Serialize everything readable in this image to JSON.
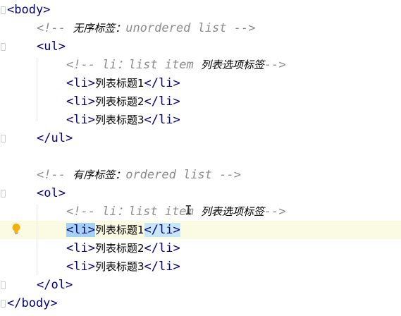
{
  "lines": [
    {
      "indent": 0,
      "tokens": [
        {
          "t": "tag",
          "v": "<body>"
        }
      ]
    },
    {
      "indent": 1,
      "tokens": [
        {
          "t": "comment",
          "v": "<!-- "
        },
        {
          "t": "comment-cn",
          "v": "无序标签："
        },
        {
          "t": "comment",
          "v": "unordered list -->"
        }
      ]
    },
    {
      "indent": 1,
      "tokens": [
        {
          "t": "tag",
          "v": "<ul>"
        }
      ]
    },
    {
      "indent": 2,
      "tokens": [
        {
          "t": "comment",
          "v": "<!-- li："
        },
        {
          "t": "comment",
          "v": "list item "
        },
        {
          "t": "comment-cn",
          "v": "列表选项标签"
        },
        {
          "t": "comment",
          "v": "-->"
        }
      ]
    },
    {
      "indent": 2,
      "tokens": [
        {
          "t": "tag",
          "v": "<li>"
        },
        {
          "t": "text",
          "v": "列表标题1"
        },
        {
          "t": "tag",
          "v": "</li>"
        }
      ]
    },
    {
      "indent": 2,
      "tokens": [
        {
          "t": "tag",
          "v": "<li>"
        },
        {
          "t": "text",
          "v": "列表标题2"
        },
        {
          "t": "tag",
          "v": "</li>"
        }
      ]
    },
    {
      "indent": 2,
      "tokens": [
        {
          "t": "tag",
          "v": "<li>"
        },
        {
          "t": "text",
          "v": "列表标题3"
        },
        {
          "t": "tag",
          "v": "</li>"
        }
      ]
    },
    {
      "indent": 1,
      "tokens": [
        {
          "t": "tag",
          "v": "</ul>"
        }
      ]
    },
    {
      "indent": 0,
      "tokens": []
    },
    {
      "indent": 1,
      "tokens": [
        {
          "t": "comment",
          "v": "<!-- "
        },
        {
          "t": "comment-cn",
          "v": "有序标签："
        },
        {
          "t": "comment",
          "v": "ordered list -->"
        }
      ]
    },
    {
      "indent": 1,
      "tokens": [
        {
          "t": "tag",
          "v": "<ol>"
        }
      ]
    },
    {
      "indent": 2,
      "tokens": [
        {
          "t": "comment",
          "v": "<!-- li："
        },
        {
          "t": "comment",
          "v": "list item "
        },
        {
          "t": "comment-cn",
          "v": "列表选项标签"
        },
        {
          "t": "comment",
          "v": "-->"
        }
      ]
    },
    {
      "indent": 2,
      "current": true,
      "tokens": [
        {
          "t": "tag-hl-strong",
          "v": "<li>"
        },
        {
          "t": "text",
          "v": "列表标题1"
        },
        {
          "t": "tag-hl",
          "v": "</li>"
        }
      ]
    },
    {
      "indent": 2,
      "tokens": [
        {
          "t": "tag",
          "v": "<li>"
        },
        {
          "t": "text",
          "v": "列表标题2"
        },
        {
          "t": "tag",
          "v": "</li>"
        }
      ]
    },
    {
      "indent": 2,
      "tokens": [
        {
          "t": "tag",
          "v": "<li>"
        },
        {
          "t": "text",
          "v": "列表标题3"
        },
        {
          "t": "tag",
          "v": "</li>"
        }
      ]
    },
    {
      "indent": 1,
      "tokens": [
        {
          "t": "tag",
          "v": "</ol>"
        }
      ]
    },
    {
      "indent": 0,
      "tokens": [
        {
          "t": "tag",
          "v": "</body>"
        }
      ]
    }
  ],
  "icons": {
    "intention": "lightbulb-icon",
    "cursor": "text-cursor-icon"
  },
  "colors": {
    "tag": "#000080",
    "comment": "#8c8c8c",
    "current_line": "#fbfbe3",
    "match_highlight": "#a7d1f2"
  }
}
